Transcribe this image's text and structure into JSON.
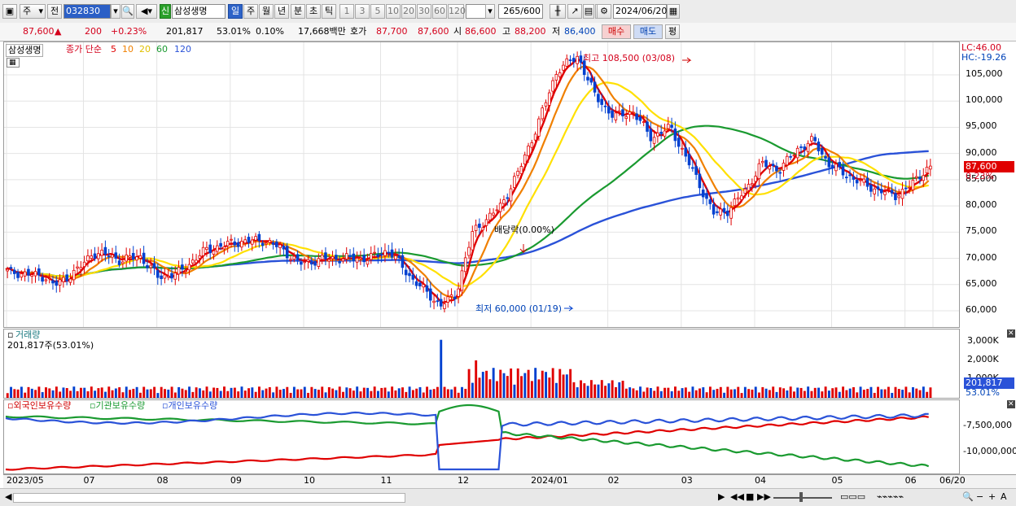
{
  "toolbar": {
    "market": "주",
    "prefix": "전",
    "code": "032830",
    "stock_name": "삼성생명",
    "new_badge": "신",
    "periods": [
      "일",
      "주",
      "월",
      "년",
      "분",
      "초",
      "틱"
    ],
    "period_selected": "일",
    "intervals": [
      "1",
      "3",
      "5",
      "10",
      "20",
      "30",
      "60",
      "120"
    ],
    "count": "265",
    "count_max": "/600",
    "date": "2024/06/20"
  },
  "quote": {
    "price": "87,600",
    "updown_arrow": "▲",
    "change": "200",
    "change_pct": "+0.23%",
    "volume": "201,817",
    "volume_ratio": "53.01%",
    "turnover": "0.10%",
    "amount": "17,668백만",
    "bid_label": "호가",
    "ask": "87,700",
    "bid": "87,600",
    "open_label": "시",
    "open": "86,600",
    "high_label": "고",
    "high": "88,200",
    "low_label": "저",
    "low": "86,400",
    "buy": "매수",
    "sell": "매도",
    "eval": "평"
  },
  "legend": {
    "stock": "삼성생명",
    "price_label": "종가 단순",
    "ma": [
      "5",
      "10",
      "20",
      "60",
      "120"
    ],
    "ma_colors": [
      "#e00000",
      "#f08000",
      "#ffe000",
      "#1a9a30",
      "#2a52d8"
    ]
  },
  "annotations": {
    "high": "최고 108,500 (03/08)",
    "low": "최저 60,000 (01/19)",
    "dividend": "배당락(0.00%)",
    "lc": "LC:46.00",
    "hc": "HC:-19.26",
    "last_price": "87,600",
    "last_pct": "0.23%"
  },
  "price_axis": [
    "105,000",
    "100,000",
    "95,000",
    "90,000",
    "85,000",
    "80,000",
    "75,000",
    "70,000",
    "65,000",
    "60,000"
  ],
  "volume_panel": {
    "title": "거래량",
    "value": "201,817주(53.01%)",
    "axis": [
      "3,000K",
      "2,000K",
      "1,000K"
    ],
    "last": "201,817",
    "last_pct": "53.01%"
  },
  "holding_panel": {
    "series": [
      "외국인보유수량",
      "기관보유수량",
      "개인보유수량"
    ],
    "axis": [
      "-7,500,000",
      "-10,000,000"
    ]
  },
  "x_axis": [
    "2023/05",
    "07",
    "08",
    "09",
    "10",
    "11",
    "12",
    "2024/01",
    "02",
    "03",
    "04",
    "05",
    "06",
    "06/20"
  ]
}
